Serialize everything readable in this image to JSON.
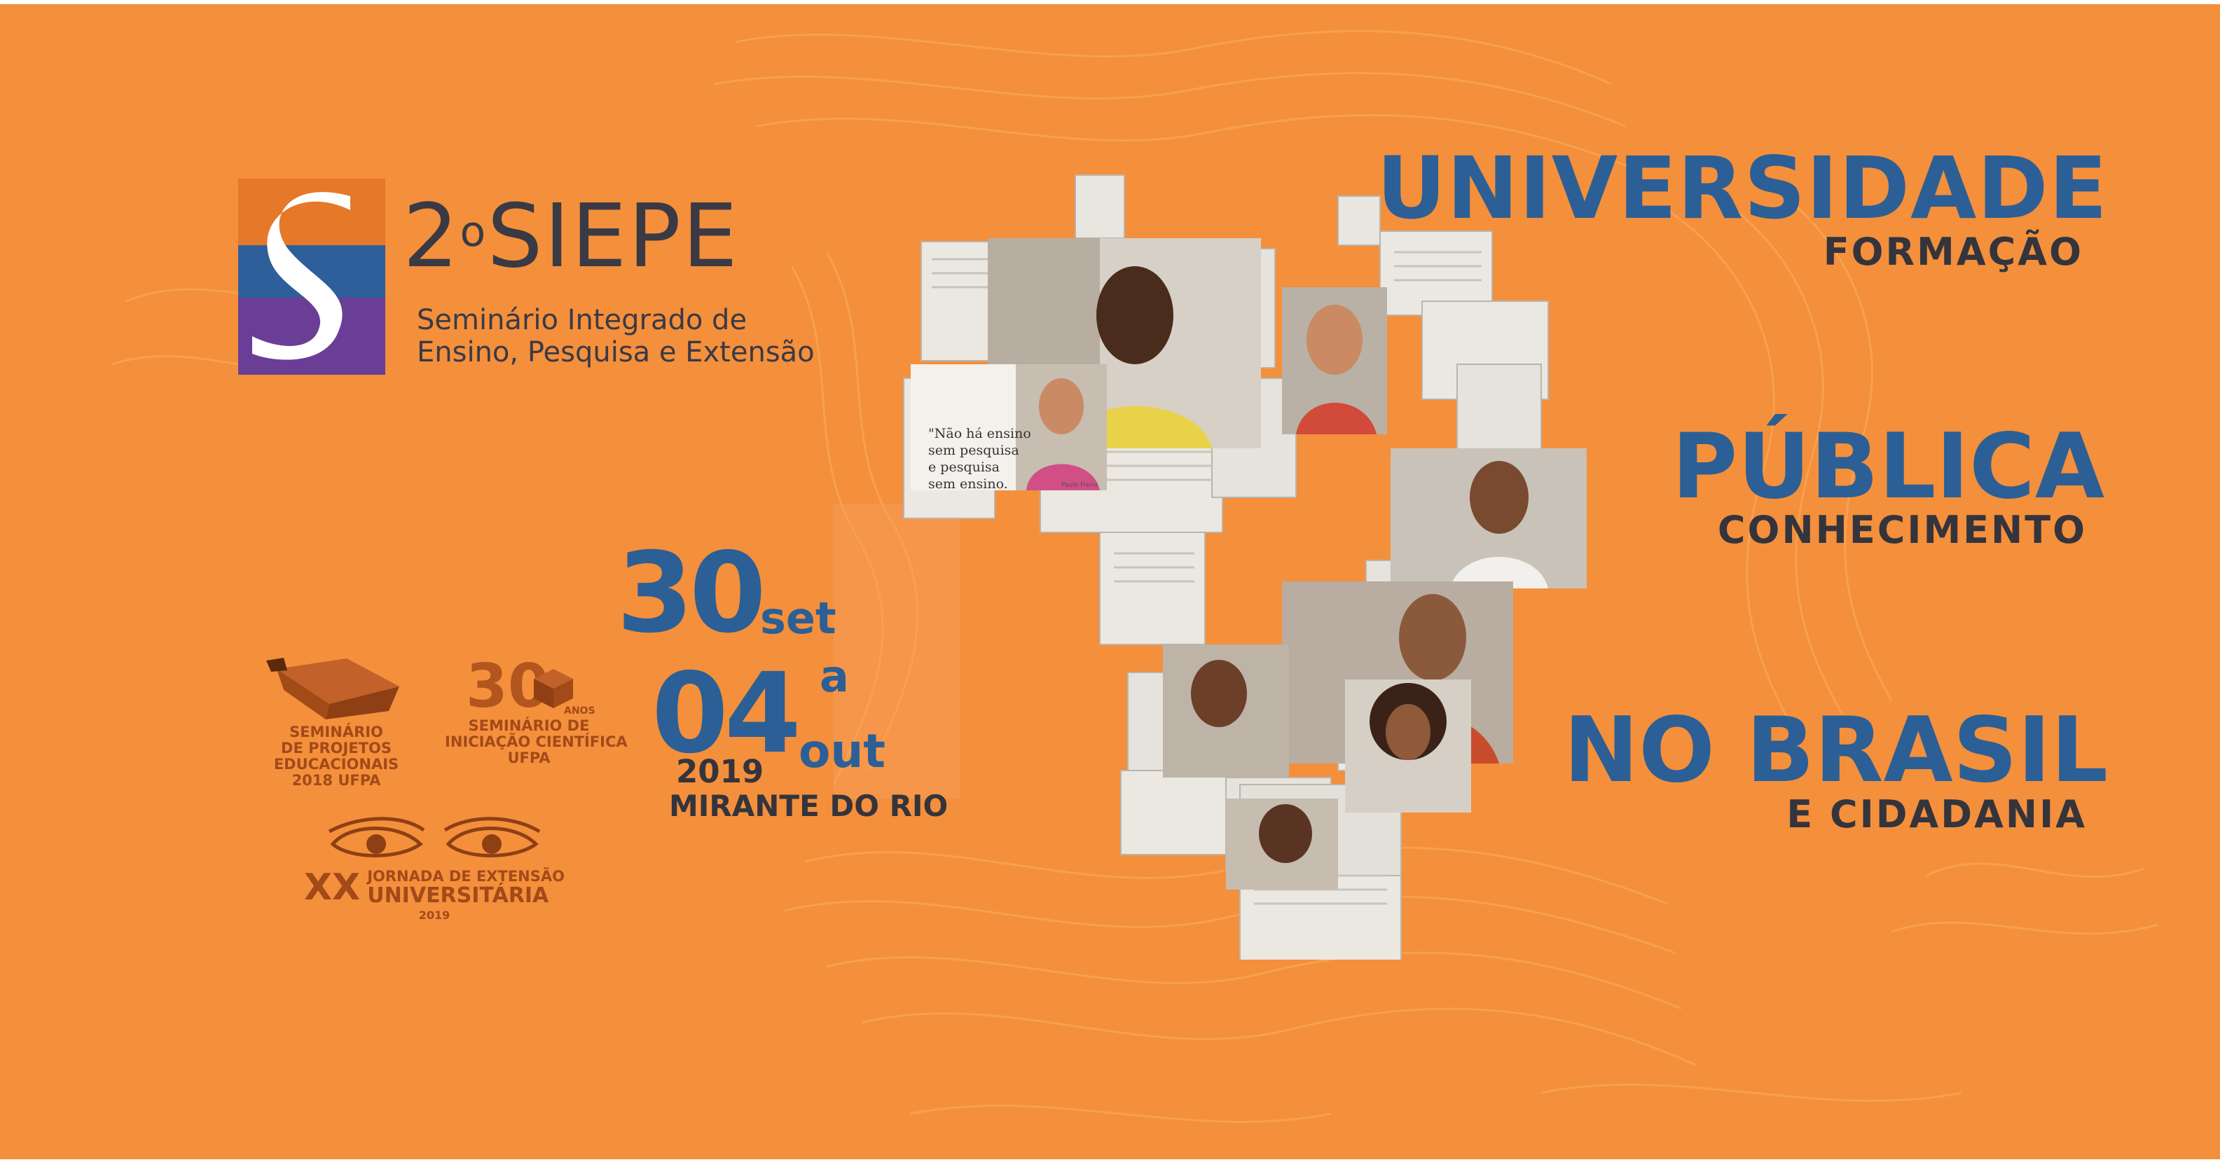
{
  "colors": {
    "background": "#f48f3c",
    "headline_blue": "#2c5f95",
    "text_dark": "#34343c",
    "partner_brown": "#a24a18",
    "logo_purple": "#6a3e96",
    "logo_blue": "#2e5f9a",
    "logo_orange": "#e6782a"
  },
  "logo": {
    "title_main": "2",
    "title_ordinal": "o",
    "title_name": "SIEPE",
    "subtitle_line1": "Seminário Integrado de",
    "subtitle_line2": "Ensino, Pesquisa e Extensão"
  },
  "dates": {
    "start_day": "30",
    "start_month": "set",
    "separator": "a",
    "end_day": "04",
    "end_month": "out",
    "year": "2019",
    "venue": "MIRANTE DO RIO"
  },
  "partners": [
    {
      "lines": [
        "SEMINÁRIO",
        "DE PROJETOS",
        "EDUCACIONAIS",
        "2018 UFPA"
      ]
    },
    {
      "number": "30",
      "badge": "ANOS",
      "lines": [
        "SEMINÁRIO DE",
        "INICIAÇÃO CIENTÍFICA",
        "UFPA"
      ]
    },
    {
      "numeral": "XX",
      "lines": [
        "JORNADA DE EXTENSÃO",
        "UNIVERSITÁRIA"
      ],
      "year": "2019"
    }
  ],
  "headline": [
    {
      "main": "UNIVERSIDADE",
      "sub": "FORMAÇÃO"
    },
    {
      "main": "PÚBLICA",
      "sub": "CONHECIMENTO"
    },
    {
      "main": "NO BRASIL",
      "sub": "E CIDADANIA"
    }
  ],
  "collage": {
    "quote": "\"Não há ensino sem pesquisa e pesquisa sem ensino.\"",
    "attribution": "Paulo Freire"
  }
}
